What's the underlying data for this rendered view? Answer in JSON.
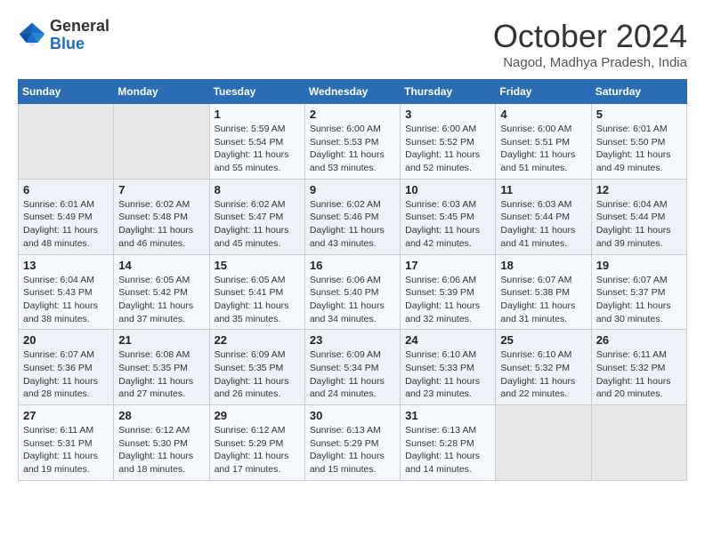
{
  "header": {
    "logo_general": "General",
    "logo_blue": "Blue",
    "month_title": "October 2024",
    "location": "Nagod, Madhya Pradesh, India"
  },
  "days_of_week": [
    "Sunday",
    "Monday",
    "Tuesday",
    "Wednesday",
    "Thursday",
    "Friday",
    "Saturday"
  ],
  "weeks": [
    [
      {
        "day": "",
        "sunrise": "",
        "sunset": "",
        "daylight": ""
      },
      {
        "day": "",
        "sunrise": "",
        "sunset": "",
        "daylight": ""
      },
      {
        "day": "1",
        "sunrise": "Sunrise: 5:59 AM",
        "sunset": "Sunset: 5:54 PM",
        "daylight": "Daylight: 11 hours and 55 minutes."
      },
      {
        "day": "2",
        "sunrise": "Sunrise: 6:00 AM",
        "sunset": "Sunset: 5:53 PM",
        "daylight": "Daylight: 11 hours and 53 minutes."
      },
      {
        "day": "3",
        "sunrise": "Sunrise: 6:00 AM",
        "sunset": "Sunset: 5:52 PM",
        "daylight": "Daylight: 11 hours and 52 minutes."
      },
      {
        "day": "4",
        "sunrise": "Sunrise: 6:00 AM",
        "sunset": "Sunset: 5:51 PM",
        "daylight": "Daylight: 11 hours and 51 minutes."
      },
      {
        "day": "5",
        "sunrise": "Sunrise: 6:01 AM",
        "sunset": "Sunset: 5:50 PM",
        "daylight": "Daylight: 11 hours and 49 minutes."
      }
    ],
    [
      {
        "day": "6",
        "sunrise": "Sunrise: 6:01 AM",
        "sunset": "Sunset: 5:49 PM",
        "daylight": "Daylight: 11 hours and 48 minutes."
      },
      {
        "day": "7",
        "sunrise": "Sunrise: 6:02 AM",
        "sunset": "Sunset: 5:48 PM",
        "daylight": "Daylight: 11 hours and 46 minutes."
      },
      {
        "day": "8",
        "sunrise": "Sunrise: 6:02 AM",
        "sunset": "Sunset: 5:47 PM",
        "daylight": "Daylight: 11 hours and 45 minutes."
      },
      {
        "day": "9",
        "sunrise": "Sunrise: 6:02 AM",
        "sunset": "Sunset: 5:46 PM",
        "daylight": "Daylight: 11 hours and 43 minutes."
      },
      {
        "day": "10",
        "sunrise": "Sunrise: 6:03 AM",
        "sunset": "Sunset: 5:45 PM",
        "daylight": "Daylight: 11 hours and 42 minutes."
      },
      {
        "day": "11",
        "sunrise": "Sunrise: 6:03 AM",
        "sunset": "Sunset: 5:44 PM",
        "daylight": "Daylight: 11 hours and 41 minutes."
      },
      {
        "day": "12",
        "sunrise": "Sunrise: 6:04 AM",
        "sunset": "Sunset: 5:44 PM",
        "daylight": "Daylight: 11 hours and 39 minutes."
      }
    ],
    [
      {
        "day": "13",
        "sunrise": "Sunrise: 6:04 AM",
        "sunset": "Sunset: 5:43 PM",
        "daylight": "Daylight: 11 hours and 38 minutes."
      },
      {
        "day": "14",
        "sunrise": "Sunrise: 6:05 AM",
        "sunset": "Sunset: 5:42 PM",
        "daylight": "Daylight: 11 hours and 37 minutes."
      },
      {
        "day": "15",
        "sunrise": "Sunrise: 6:05 AM",
        "sunset": "Sunset: 5:41 PM",
        "daylight": "Daylight: 11 hours and 35 minutes."
      },
      {
        "day": "16",
        "sunrise": "Sunrise: 6:06 AM",
        "sunset": "Sunset: 5:40 PM",
        "daylight": "Daylight: 11 hours and 34 minutes."
      },
      {
        "day": "17",
        "sunrise": "Sunrise: 6:06 AM",
        "sunset": "Sunset: 5:39 PM",
        "daylight": "Daylight: 11 hours and 32 minutes."
      },
      {
        "day": "18",
        "sunrise": "Sunrise: 6:07 AM",
        "sunset": "Sunset: 5:38 PM",
        "daylight": "Daylight: 11 hours and 31 minutes."
      },
      {
        "day": "19",
        "sunrise": "Sunrise: 6:07 AM",
        "sunset": "Sunset: 5:37 PM",
        "daylight": "Daylight: 11 hours and 30 minutes."
      }
    ],
    [
      {
        "day": "20",
        "sunrise": "Sunrise: 6:07 AM",
        "sunset": "Sunset: 5:36 PM",
        "daylight": "Daylight: 11 hours and 28 minutes."
      },
      {
        "day": "21",
        "sunrise": "Sunrise: 6:08 AM",
        "sunset": "Sunset: 5:35 PM",
        "daylight": "Daylight: 11 hours and 27 minutes."
      },
      {
        "day": "22",
        "sunrise": "Sunrise: 6:09 AM",
        "sunset": "Sunset: 5:35 PM",
        "daylight": "Daylight: 11 hours and 26 minutes."
      },
      {
        "day": "23",
        "sunrise": "Sunrise: 6:09 AM",
        "sunset": "Sunset: 5:34 PM",
        "daylight": "Daylight: 11 hours and 24 minutes."
      },
      {
        "day": "24",
        "sunrise": "Sunrise: 6:10 AM",
        "sunset": "Sunset: 5:33 PM",
        "daylight": "Daylight: 11 hours and 23 minutes."
      },
      {
        "day": "25",
        "sunrise": "Sunrise: 6:10 AM",
        "sunset": "Sunset: 5:32 PM",
        "daylight": "Daylight: 11 hours and 22 minutes."
      },
      {
        "day": "26",
        "sunrise": "Sunrise: 6:11 AM",
        "sunset": "Sunset: 5:32 PM",
        "daylight": "Daylight: 11 hours and 20 minutes."
      }
    ],
    [
      {
        "day": "27",
        "sunrise": "Sunrise: 6:11 AM",
        "sunset": "Sunset: 5:31 PM",
        "daylight": "Daylight: 11 hours and 19 minutes."
      },
      {
        "day": "28",
        "sunrise": "Sunrise: 6:12 AM",
        "sunset": "Sunset: 5:30 PM",
        "daylight": "Daylight: 11 hours and 18 minutes."
      },
      {
        "day": "29",
        "sunrise": "Sunrise: 6:12 AM",
        "sunset": "Sunset: 5:29 PM",
        "daylight": "Daylight: 11 hours and 17 minutes."
      },
      {
        "day": "30",
        "sunrise": "Sunrise: 6:13 AM",
        "sunset": "Sunset: 5:29 PM",
        "daylight": "Daylight: 11 hours and 15 minutes."
      },
      {
        "day": "31",
        "sunrise": "Sunrise: 6:13 AM",
        "sunset": "Sunset: 5:28 PM",
        "daylight": "Daylight: 11 hours and 14 minutes."
      },
      {
        "day": "",
        "sunrise": "",
        "sunset": "",
        "daylight": ""
      },
      {
        "day": "",
        "sunrise": "",
        "sunset": "",
        "daylight": ""
      }
    ]
  ]
}
